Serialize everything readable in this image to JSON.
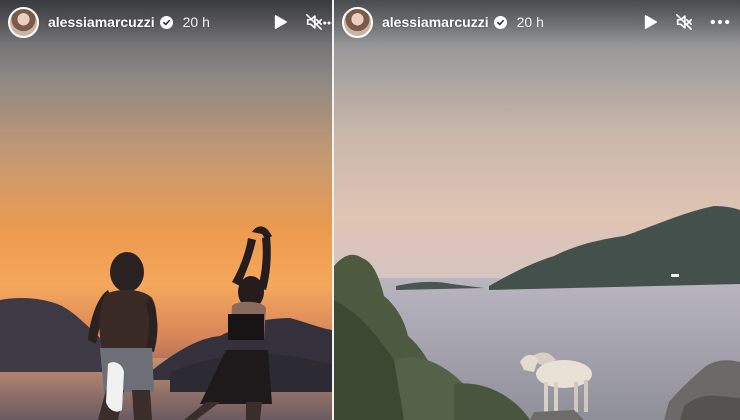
{
  "stories": [
    {
      "username": "alessiamarcuzzi",
      "time": "20 h",
      "verified": true,
      "scene": "sunset-dancers"
    },
    {
      "username": "alessiamarcuzzi",
      "time": "20 h",
      "verified": true,
      "scene": "sea-goat"
    }
  ],
  "icons": {
    "play": "play-icon",
    "mute": "volume-muted-icon",
    "more": "more-options-icon",
    "verified": "verified-badge-icon"
  },
  "colors": {
    "header_text": "#ffffff",
    "divider": "#f2f2f2"
  }
}
